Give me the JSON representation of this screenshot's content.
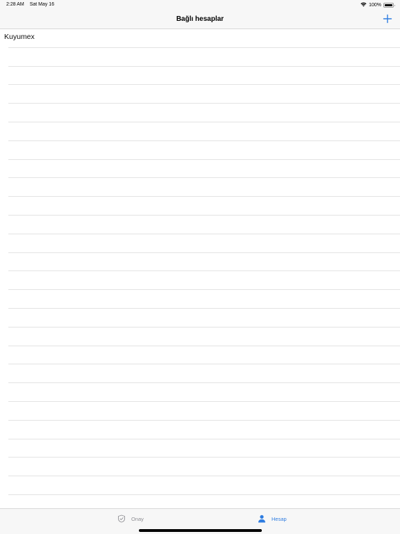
{
  "status": {
    "time": "2:28 AM",
    "date": "Sat May 16",
    "battery": "100%",
    "battery_level": 1.0
  },
  "nav": {
    "title": "Bağlı hesaplar",
    "add_icon": "plus-icon",
    "accent_color": "#2f7de1"
  },
  "accounts": [
    {
      "name": "Kuyumex"
    }
  ],
  "tabs": [
    {
      "label": "Onay",
      "icon": "shield-check-icon",
      "selected": false
    },
    {
      "label": "Hesap",
      "icon": "person-icon",
      "selected": true
    }
  ]
}
